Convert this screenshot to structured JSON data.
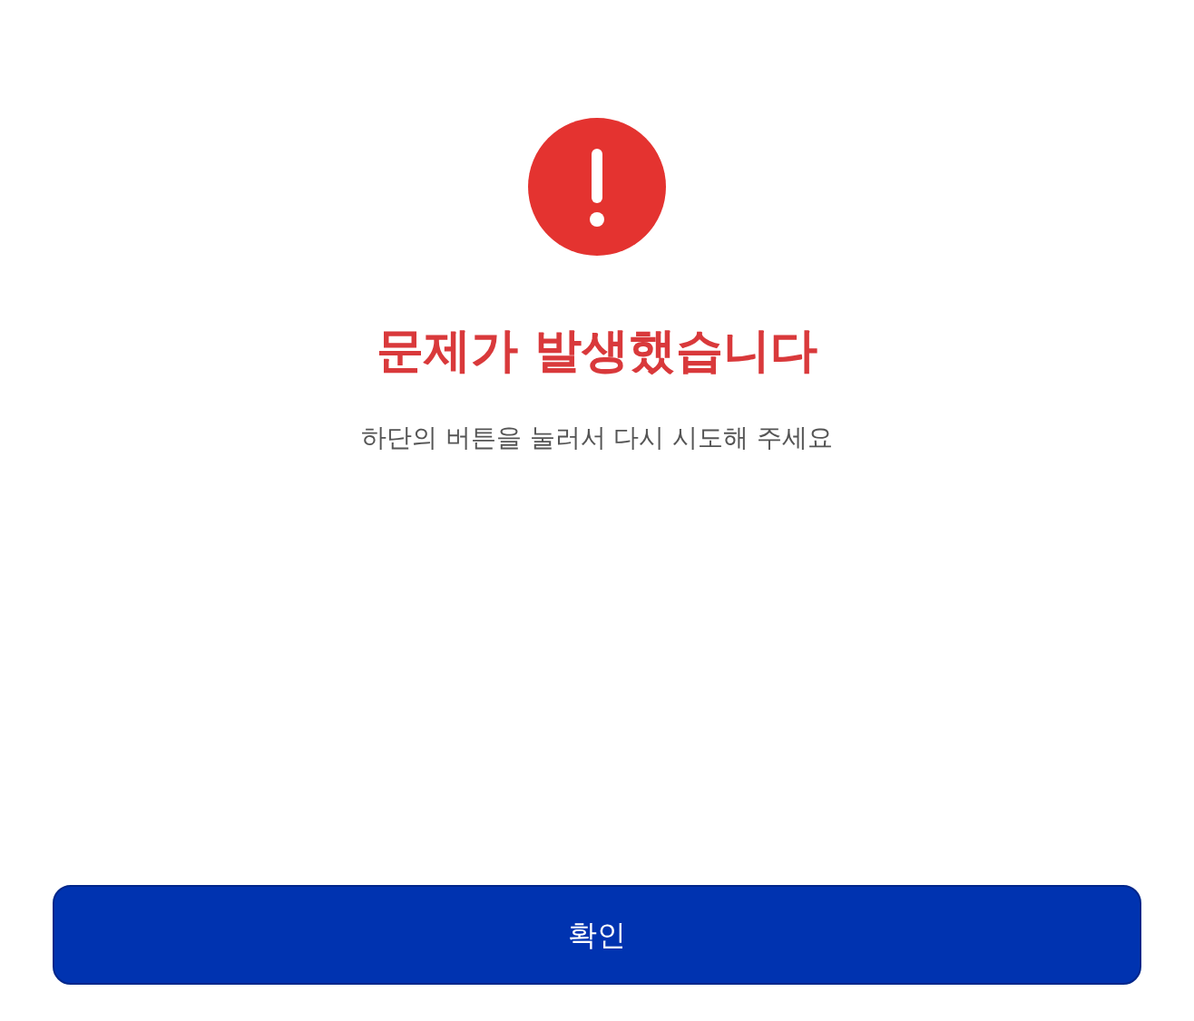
{
  "alert": {
    "title": "문제가 발생했습니다",
    "message": "하단의 버튼을 눌러서 다시 시도해 주세요"
  },
  "buttons": [
    {
      "label": "확인"
    }
  ]
}
